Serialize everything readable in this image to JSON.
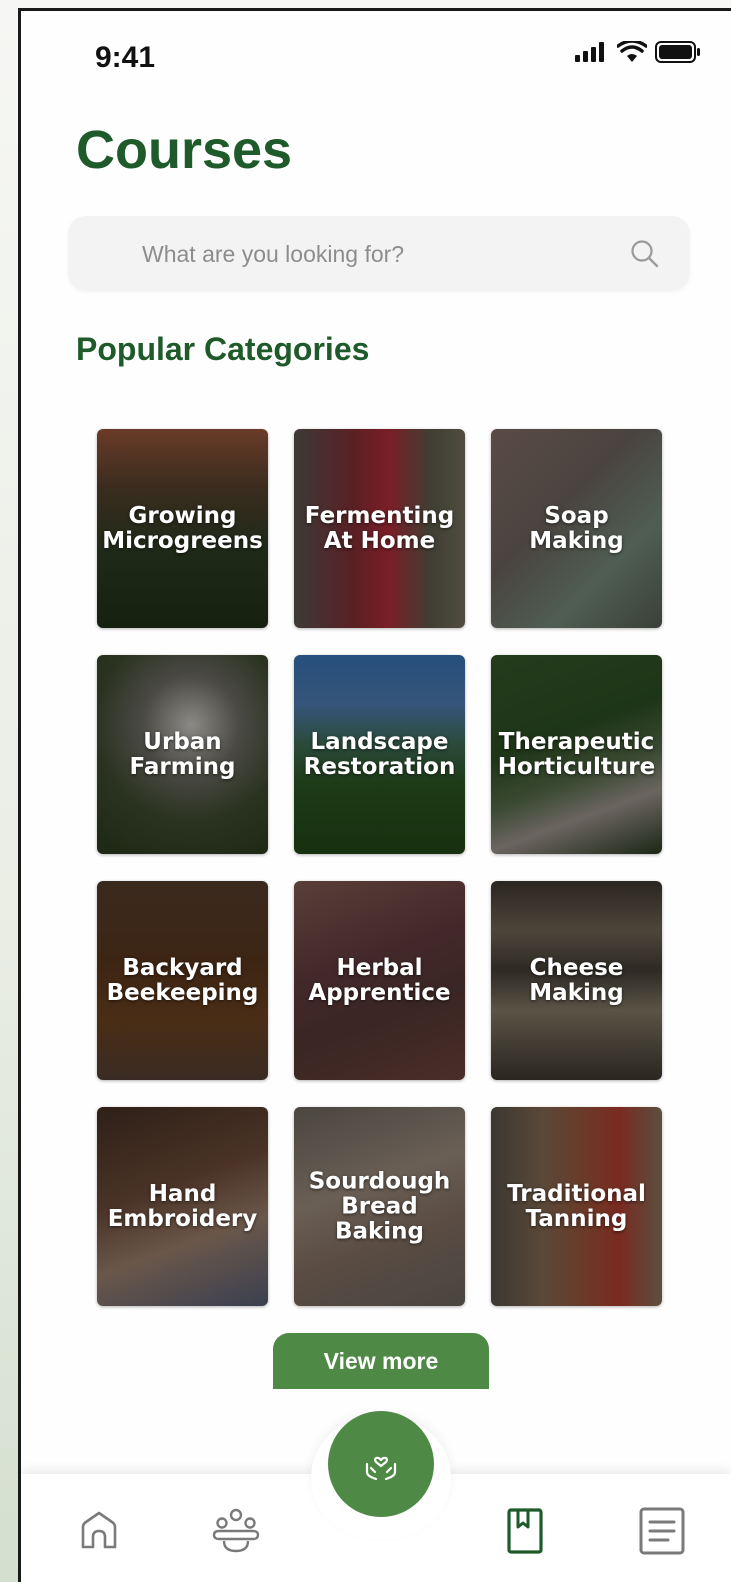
{
  "status_bar": {
    "time": "9:41",
    "icons": [
      "signal-icon",
      "wifi-icon",
      "battery-icon"
    ]
  },
  "header": {
    "title": "Courses"
  },
  "search": {
    "placeholder": "What are you looking for?"
  },
  "categories": {
    "title": "Popular Categories",
    "items": [
      {
        "label": "Growing\nMicrogreens"
      },
      {
        "label": "Fermenting\nAt Home"
      },
      {
        "label": "Soap\nMaking"
      },
      {
        "label": "Urban\nFarming"
      },
      {
        "label": "Landscape\nRestoration"
      },
      {
        "label": "Therapeutic\nHorticulture"
      },
      {
        "label": "Backyard\nBeekeeping"
      },
      {
        "label": "Herbal\nApprentice"
      },
      {
        "label": "Cheese\nMaking"
      },
      {
        "label": "Hand\nEmbroidery"
      },
      {
        "label": "Sourdough\nBread\nBaking"
      },
      {
        "label": "Traditional\nTanning"
      }
    ],
    "view_more": "View more"
  },
  "tab_bar": {
    "items": [
      "home-icon",
      "community-icon",
      "care-icon",
      "bookmark-icon",
      "notes-icon"
    ],
    "active": "bookmark-icon"
  },
  "colors": {
    "brand_green": "#1e5a2a",
    "accent_green": "#4e8a45"
  }
}
